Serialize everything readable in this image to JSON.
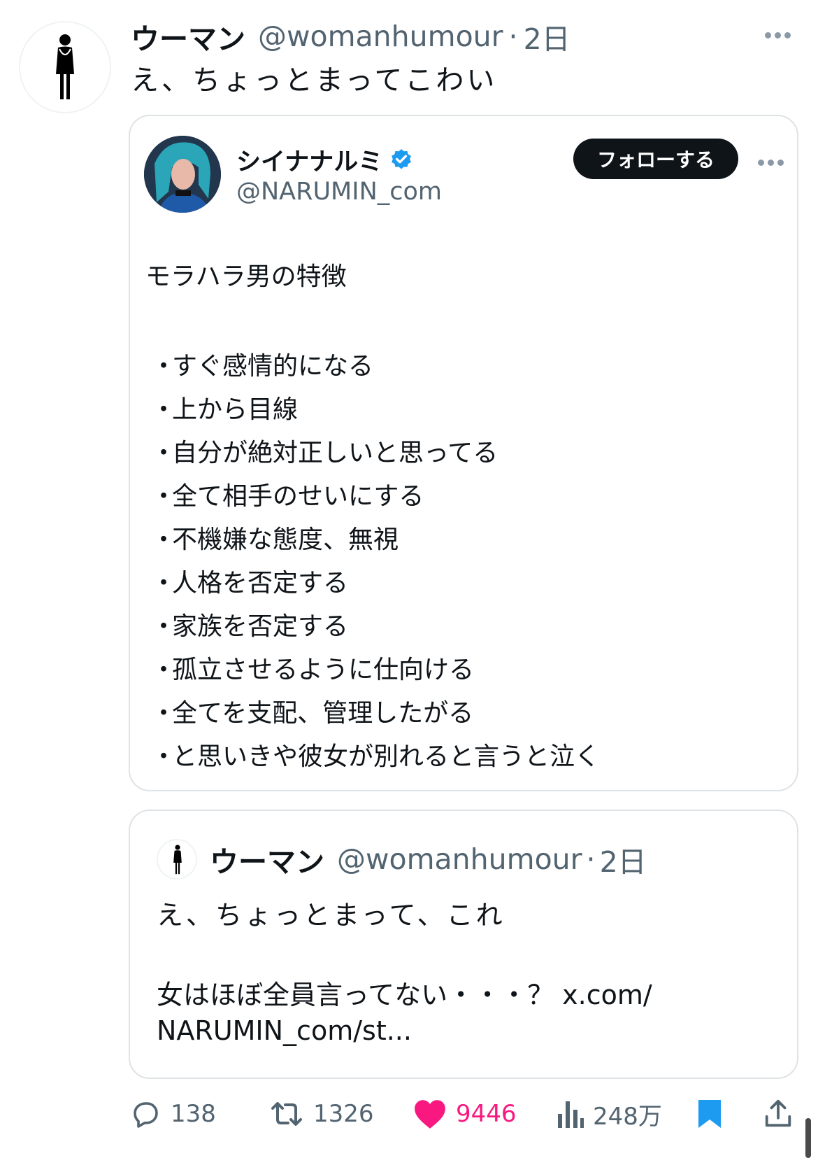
{
  "tweet": {
    "author_name": "ウーマン",
    "author_handle": "@womanhumour",
    "separator": "·",
    "time": "2日",
    "text": "え、ちょっとまってこわい"
  },
  "embedded": {
    "author_name": "シイナナルミ",
    "author_handle": "@NARUMIN_com",
    "follow_label": "フォローする",
    "title": "モラハラ男の特徴",
    "items": [
      "すぐ感情的になる",
      "上から目線",
      "自分が絶対正しいと思ってる",
      "全て相手のせいにする",
      "不機嫌な態度、無視",
      "人格を否定する",
      "家族を否定する",
      "孤立させるように仕向ける",
      "全てを支配、管理したがる",
      "と思いきや彼女が別れると言うと泣く"
    ]
  },
  "quote": {
    "author_name": "ウーマン",
    "author_handle": "@womanhumour",
    "separator": "·",
    "time": "2日",
    "line1": "え、ちょっとまって、これ",
    "line2": "女はほぼ全員言ってない・・・？ x.com/",
    "line3": "NARUMIN_com/st..."
  },
  "actions": {
    "replies": "138",
    "retweets": "1326",
    "likes": "9446",
    "views": "248万"
  },
  "colors": {
    "like": "#f91880",
    "bookmark": "#1d9bf0",
    "verified": "#1d9bf0",
    "muted": "#536471"
  }
}
